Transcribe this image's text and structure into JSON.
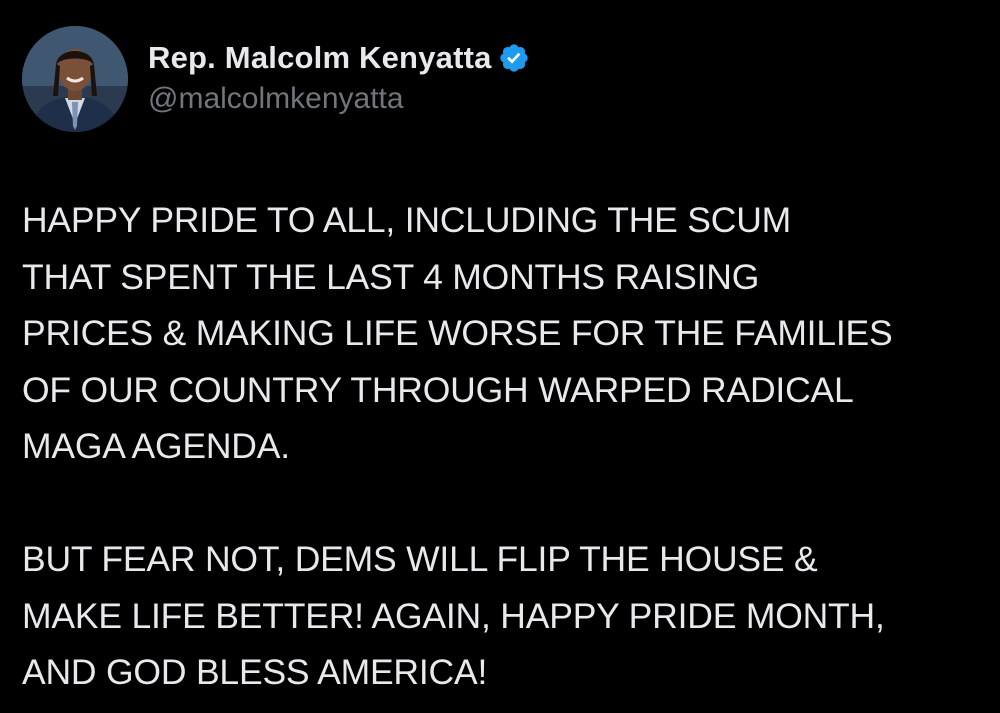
{
  "tweet": {
    "author": {
      "display_name": "Rep. Malcolm Kenyatta",
      "handle": "@malcolmkenyatta",
      "verified": true,
      "verified_badge_icon": "verified-badge-icon",
      "verified_color": "#1d9bf0"
    },
    "body": {
      "paragraphs": [
        {
          "lines": [
            "HAPPY PRIDE TO ALL, INCLUDING THE SCUM",
            "THAT SPENT THE LAST 4 MONTHS RAISING",
            "PRICES & MAKING LIFE WORSE FOR THE FAMILIES",
            "OF OUR COUNTRY THROUGH WARPED RADICAL",
            "MAGA AGENDA."
          ]
        },
        {
          "lines": [
            "BUT FEAR NOT, DEMS WILL FLIP THE HOUSE &",
            "MAKE LIFE BETTER! AGAIN, HAPPY PRIDE MONTH,",
            "AND GOD BLESS AMERICA!"
          ]
        }
      ]
    }
  },
  "theme": {
    "background": "#000000",
    "text": "#e7e9ea",
    "secondary_text": "#71767b"
  }
}
